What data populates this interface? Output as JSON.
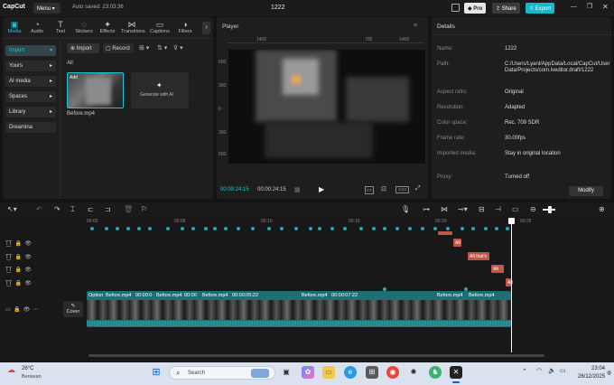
{
  "titlebar": {
    "app_name": "CapCut",
    "menu_label": "Menu",
    "autosave": "Auto saved: 23:03:36",
    "project_title": "1222",
    "pro_label": "Pro",
    "share_label": "Share",
    "export_label": "Export"
  },
  "toolbar": {
    "tabs": [
      {
        "label": "Media",
        "icon": "media-icon"
      },
      {
        "label": "Audio",
        "icon": "audio-icon"
      },
      {
        "label": "Text",
        "icon": "text-icon"
      },
      {
        "label": "Stickers",
        "icon": "stickers-icon"
      },
      {
        "label": "Effects",
        "icon": "effects-icon"
      },
      {
        "label": "Transitions",
        "icon": "transitions-icon"
      },
      {
        "label": "Captions",
        "icon": "captions-icon"
      },
      {
        "label": "Filters",
        "icon": "filters-icon"
      }
    ]
  },
  "sidebar": {
    "items": [
      "Import",
      "Yours",
      "AI media",
      "Spaces",
      "Library",
      "Dreamina"
    ]
  },
  "media": {
    "import_label": "Import",
    "record_label": "Record",
    "all_label": "All",
    "clip_name": "Before.mp4",
    "clip_badge": "Add",
    "generate_label": "Generate with AI"
  },
  "player": {
    "title": "Player",
    "ruler": [
      "1400",
      "700",
      "1400"
    ],
    "side_ruler": [
      "600",
      "300",
      "0",
      "300",
      "600"
    ],
    "current_time": "00:00:24:15",
    "total_time": "00:00:24:15"
  },
  "details": {
    "title": "Details",
    "rows": [
      {
        "label": "Name:",
        "value": "1222"
      },
      {
        "label": "Path:",
        "value": "C:/Users/Lyanl/AppData/Local/CapCut/User Data/Projects/com.lveditor.draft/1222"
      },
      {
        "label": "Aspect ratio:",
        "value": "Original"
      },
      {
        "label": "Resolution:",
        "value": "Adapted"
      },
      {
        "label": "Color space:",
        "value": "Rec. 709 SDR"
      },
      {
        "label": "Frame rate:",
        "value": "30.00fps"
      },
      {
        "label": "Imported media:",
        "value": "Stay in original location"
      },
      {
        "label": "Proxy:",
        "value": "Turned off"
      }
    ],
    "modify_label": "Modify"
  },
  "timeline": {
    "ruler": [
      "00:00",
      "00:05",
      "00:10",
      "00:15",
      "00:20",
      "00:25"
    ],
    "red_clips": [
      "Alt",
      "Alt  that's",
      "Alt",
      "Alt"
    ],
    "video_labels": [
      "Option",
      "Before.mp4",
      "00:00:0",
      "Before.mp4",
      "00:00",
      "Before.mp4",
      "00:00:05:22",
      "Before.mp4",
      "00:00:07:22",
      "Before.mp4",
      "Before.mp4"
    ],
    "cover_label": "Cover"
  },
  "taskbar": {
    "weather_temp": "26°C",
    "weather_desc": "Berawan",
    "search_placeholder": "Search",
    "time": "23:04",
    "date": "26/12/2025"
  },
  "colors": {
    "accent": "#1fc4d4",
    "export": "#17b8c8",
    "clip_teal": "#1d6f75",
    "text_clip": "#c0574a"
  }
}
